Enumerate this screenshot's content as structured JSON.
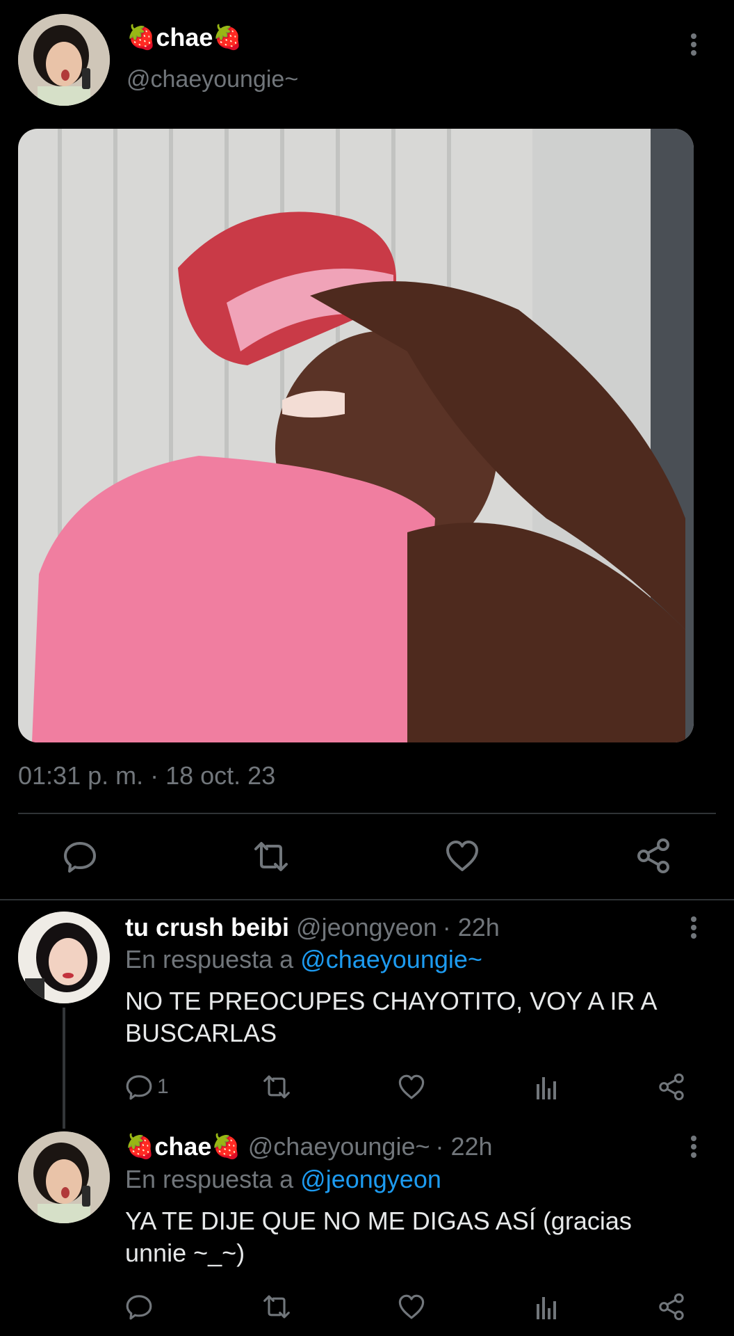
{
  "main_tweet": {
    "display_name": "chae",
    "name_emoji": "🍓",
    "handle": "@chaeyoungie~",
    "timestamp": "01:31 p. m. · 18 oct. 23"
  },
  "replies": [
    {
      "display_name": "tu crush beibi",
      "handle": "@jeongyeon",
      "time": "· 22h",
      "reply_prefix": "En respuesta a",
      "reply_to": "@chaeyoungie~",
      "text": "NO TE PREOCUPES CHAYOTITO, VOY A IR A BUSCARLAS",
      "reply_count": "1"
    },
    {
      "display_name": "chae",
      "name_emoji": "🍓",
      "handle": "@chaeyoungie~",
      "time": "· 22h",
      "reply_prefix": "En respuesta a",
      "reply_to": "@jeongyeon",
      "text": "YA TE DIJE QUE NO ME DIGAS ASÍ (gracias unnie ~_~)"
    }
  ],
  "icons": {
    "reply": "reply-icon",
    "retweet": "retweet-icon",
    "like": "heart-icon",
    "views": "views-icon",
    "share": "share-icon",
    "more": "more-options-icon"
  },
  "colors": {
    "background": "#000000",
    "text": "#e7e9ea",
    "muted": "#71767b",
    "link": "#1d9bf0",
    "divider": "#2f3336"
  }
}
